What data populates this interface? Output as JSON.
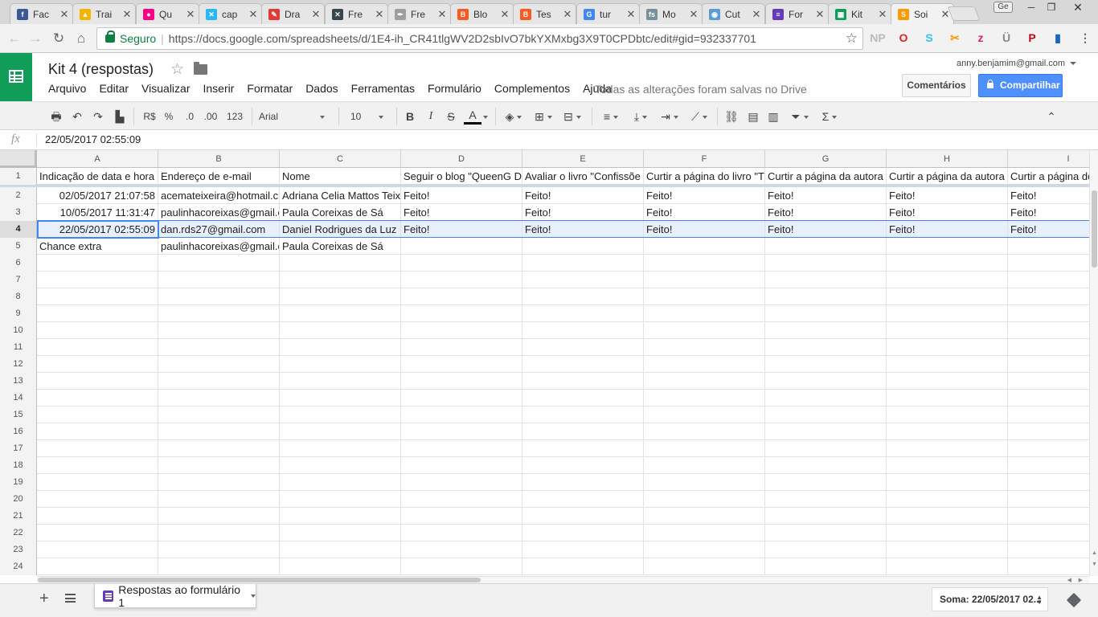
{
  "browser": {
    "tabs": [
      {
        "label": "Fac",
        "icon": "facebook-icon",
        "color": "#3b5998",
        "glyph": "f"
      },
      {
        "label": "Trai",
        "icon": "google-drive-icon",
        "color": "#f4b400",
        "glyph": "▲"
      },
      {
        "label": "Qu",
        "icon": "flickr-icon",
        "color": "#ff0084",
        "glyph": "●"
      },
      {
        "label": "cap",
        "icon": "extension-icon",
        "color": "#29b6f6",
        "glyph": "✕"
      },
      {
        "label": "Dra",
        "icon": "draw-icon",
        "color": "#e53935",
        "glyph": "✎"
      },
      {
        "label": "Fre",
        "icon": "freepik-icon",
        "color": "#37474f",
        "glyph": "✕"
      },
      {
        "label": "Fre",
        "icon": "pen-icon",
        "color": "#9e9e9e",
        "glyph": "✒"
      },
      {
        "label": "Blo",
        "icon": "blogger-icon",
        "color": "#ff5722",
        "glyph": "B"
      },
      {
        "label": "Tes",
        "icon": "blogger-icon",
        "color": "#ff5722",
        "glyph": "B"
      },
      {
        "label": "tur",
        "icon": "google-icon",
        "color": "#4285f4",
        "glyph": "G"
      },
      {
        "label": "Mo",
        "icon": "font-icon",
        "color": "#78909c",
        "glyph": "fs"
      },
      {
        "label": "Cut",
        "icon": "cut-icon",
        "color": "#5c9bd6",
        "glyph": "◉"
      },
      {
        "label": "For",
        "icon": "google-forms-icon",
        "color": "#673ab7",
        "glyph": "≡"
      },
      {
        "label": "Kit",
        "icon": "google-sheets-icon",
        "color": "#0f9d58",
        "glyph": "▦"
      },
      {
        "label": "Soi",
        "icon": "loading-icon",
        "color": "#ff9800",
        "glyph": "S"
      }
    ],
    "active_tab": 14,
    "profile_label": "Ge",
    "security_label": "Seguro",
    "url": "https://docs.google.com/spreadsheets/d/1E4-ih_CR41tlgWV2D2sbIvO7bkYXMxbg3X9T0CPDbtc/edit#gid=932337701",
    "extensions": [
      {
        "name": "np-extension-icon",
        "glyph": "NP",
        "color": "#bbbbbb"
      },
      {
        "name": "opera-icon",
        "glyph": "O",
        "color": "#e2231a"
      },
      {
        "name": "slack-icon",
        "glyph": "S",
        "color": "#36c5f0"
      },
      {
        "name": "scissors-icon",
        "glyph": "✂",
        "color": "#ff9800"
      },
      {
        "name": "z-extension-icon",
        "glyph": "z",
        "color": "#e91e63"
      },
      {
        "name": "u-extension-icon",
        "glyph": "Ü",
        "color": "#888888"
      },
      {
        "name": "pinterest-icon",
        "glyph": "P",
        "color": "#bd081c"
      },
      {
        "name": "bookmark-icon",
        "glyph": "▮",
        "color": "#1565c0"
      },
      {
        "name": "menu-icon",
        "glyph": "⋮",
        "color": "#555555"
      }
    ]
  },
  "doc": {
    "title": "Kit 4 (respostas)",
    "menu": [
      "Arquivo",
      "Editar",
      "Visualizar",
      "Inserir",
      "Formatar",
      "Dados",
      "Ferramentas",
      "Formulário",
      "Complementos",
      "Ajuda"
    ],
    "save_status": "Todas as alterações foram salvas no Drive",
    "account": "anny.benjamim@gmail.com",
    "comments_label": "Comentários",
    "share_label": "Compartilhar"
  },
  "toolbar": {
    "currency": "R$",
    "percent": "%",
    "dec_decrease": ".0",
    "dec_increase": ".00",
    "format_more": "123",
    "font": "Arial",
    "font_size": "10",
    "bold": "B",
    "italic": "I",
    "strike": "S",
    "text_color": "A"
  },
  "formula_bar": {
    "fx_label": "fx",
    "value": "22/05/2017 02:55:09"
  },
  "sheet": {
    "columns": [
      "A",
      "B",
      "C",
      "D",
      "E",
      "F",
      "G",
      "H",
      "I"
    ],
    "selected_row": 4,
    "rows": [
      [
        "Indicação de data e hora",
        "Endereço de e-mail",
        "Nome",
        "Seguir o blog \"QueenG D",
        "Avaliar o livro \"Confissõe",
        "Curtir a página do livro \"T",
        "Curtir a página da autora",
        "Curtir a página da autora",
        "Curtir a página do"
      ],
      [
        "02/05/2017 21:07:58",
        "acemateixeira@hotmail.c",
        "Adriana Celia Mattos Teix",
        "Feito!",
        "Feito!",
        "Feito!",
        "Feito!",
        "Feito!",
        "Feito!"
      ],
      [
        "10/05/2017 11:31:47",
        "paulinhacoreixas@gmail.c",
        "Paula Coreixas de Sá",
        "Feito!",
        "Feito!",
        "Feito!",
        "Feito!",
        "Feito!",
        "Feito!"
      ],
      [
        "22/05/2017 02:55:09",
        "dan.rds27@gmail.com",
        "Daniel Rodrigues da Luz",
        "Feito!",
        "Feito!",
        "Feito!",
        "Feito!",
        "Feito!",
        "Feito!"
      ],
      [
        "Chance extra",
        "paulinhacoreixas@gmail.c",
        "Paula Coreixas de Sá",
        "",
        "",
        "",
        "",
        "",
        ""
      ],
      [
        "",
        "",
        "",
        "",
        "",
        "",
        "",
        "",
        ""
      ],
      [
        "",
        "",
        "",
        "",
        "",
        "",
        "",
        "",
        ""
      ],
      [
        "",
        "",
        "",
        "",
        "",
        "",
        "",
        "",
        ""
      ],
      [
        "",
        "",
        "",
        "",
        "",
        "",
        "",
        "",
        ""
      ],
      [
        "",
        "",
        "",
        "",
        "",
        "",
        "",
        "",
        ""
      ],
      [
        "",
        "",
        "",
        "",
        "",
        "",
        "",
        "",
        ""
      ],
      [
        "",
        "",
        "",
        "",
        "",
        "",
        "",
        "",
        ""
      ],
      [
        "",
        "",
        "",
        "",
        "",
        "",
        "",
        "",
        ""
      ],
      [
        "",
        "",
        "",
        "",
        "",
        "",
        "",
        "",
        ""
      ],
      [
        "",
        "",
        "",
        "",
        "",
        "",
        "",
        "",
        ""
      ],
      [
        "",
        "",
        "",
        "",
        "",
        "",
        "",
        "",
        ""
      ],
      [
        "",
        "",
        "",
        "",
        "",
        "",
        "",
        "",
        ""
      ],
      [
        "",
        "",
        "",
        "",
        "",
        "",
        "",
        "",
        ""
      ],
      [
        "",
        "",
        "",
        "",
        "",
        "",
        "",
        "",
        ""
      ],
      [
        "",
        "",
        "",
        "",
        "",
        "",
        "",
        "",
        ""
      ],
      [
        "",
        "",
        "",
        "",
        "",
        "",
        "",
        "",
        ""
      ],
      [
        "",
        "",
        "",
        "",
        "",
        "",
        "",
        "",
        ""
      ],
      [
        "",
        "",
        "",
        "",
        "",
        "",
        "",
        "",
        ""
      ],
      [
        "",
        "",
        "",
        "",
        "",
        "",
        "",
        "",
        ""
      ]
    ]
  },
  "footer": {
    "sheet_tab": "Respostas ao formulário 1",
    "sum": "Soma: 22/05/2017 02..."
  }
}
